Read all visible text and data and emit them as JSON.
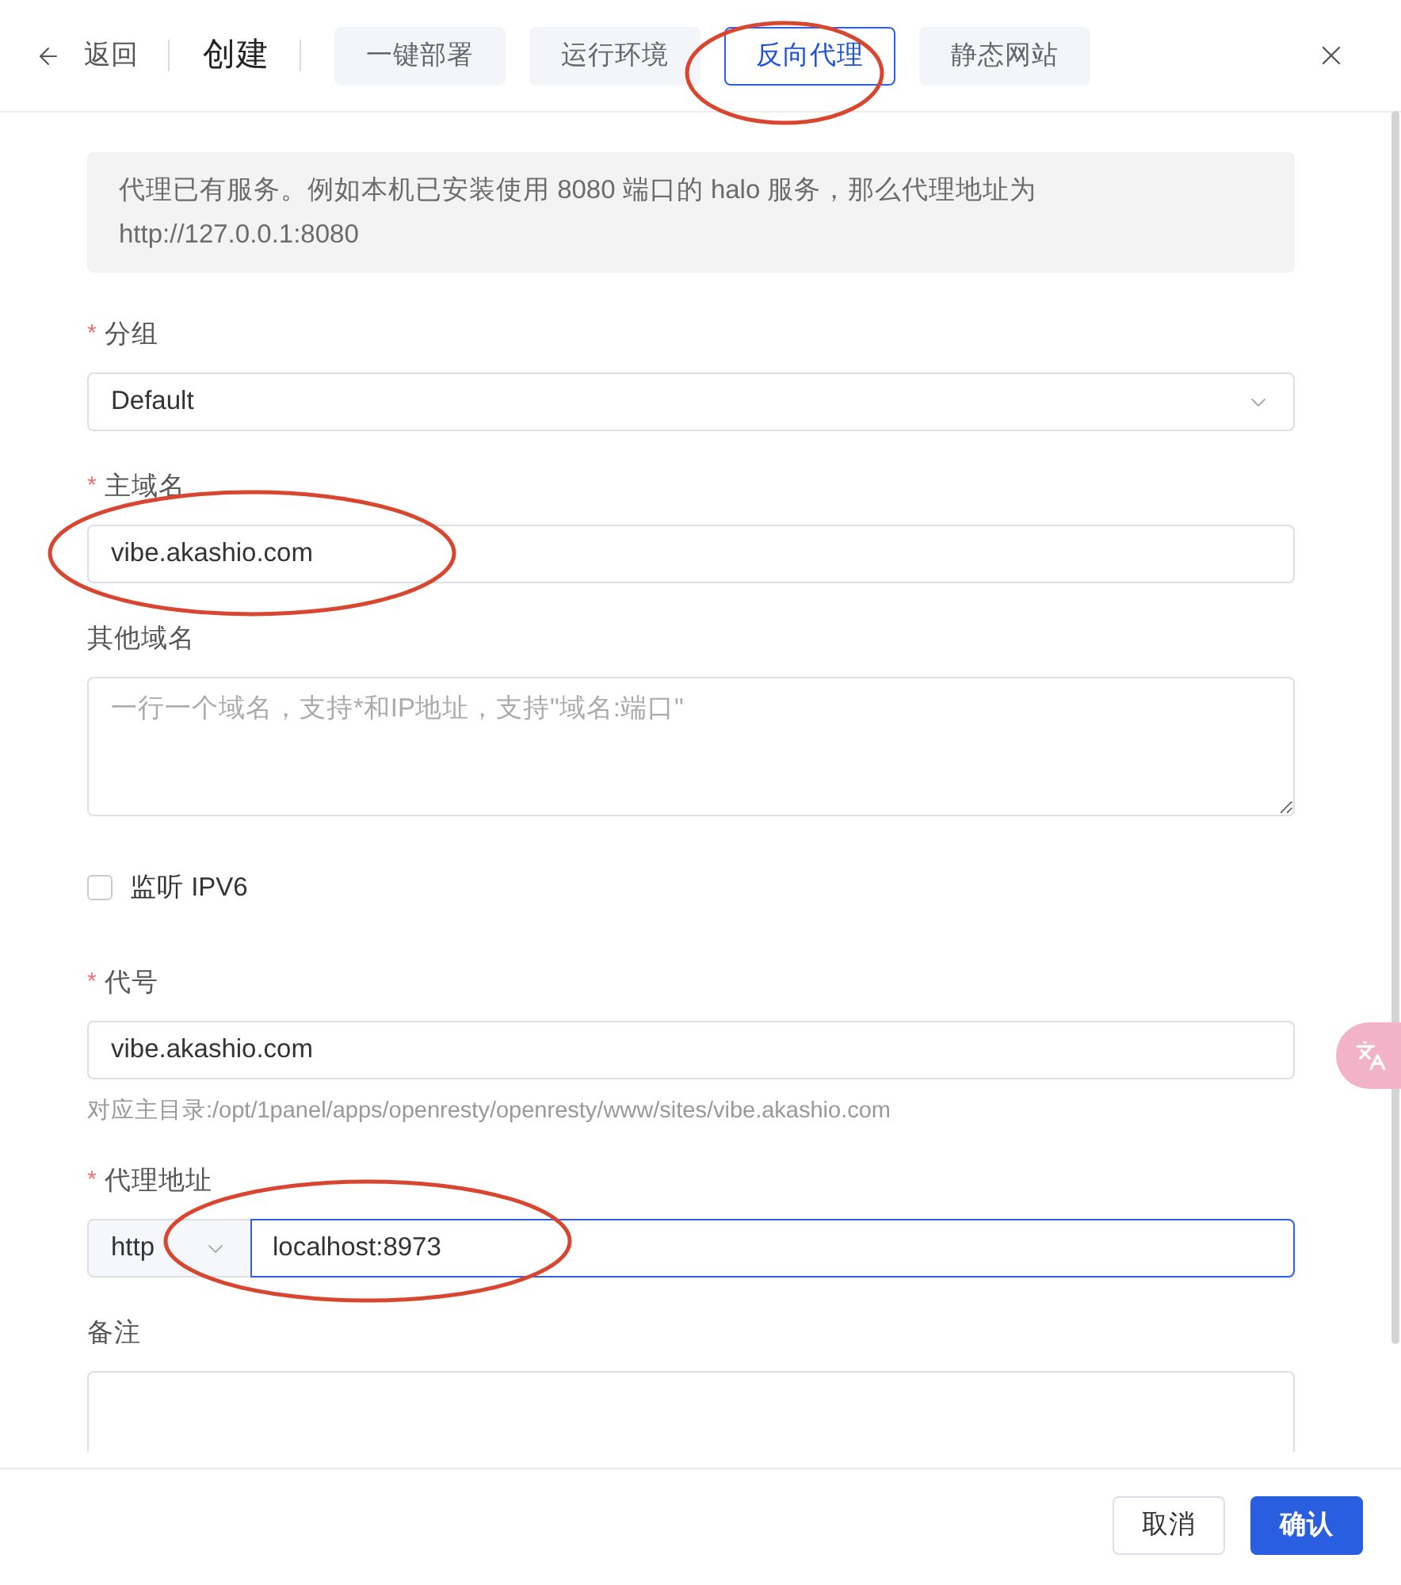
{
  "header": {
    "back": {
      "label": "返回"
    },
    "title": "创建",
    "tabs": [
      {
        "label": "一键部署",
        "selected": false,
        "annotated": false
      },
      {
        "label": "运行环境",
        "selected": false,
        "annotated": false
      },
      {
        "label": "反向代理",
        "selected": true,
        "annotated": true
      },
      {
        "label": "静态网站",
        "selected": false,
        "annotated": false
      }
    ]
  },
  "info": {
    "text": "代理已有服务。例如本机已安装使用 8080 端口的 halo 服务，那么代理地址为 http://127.0.0.1:8080"
  },
  "form": {
    "fields": [
      {
        "kind": "select",
        "required_mark": "*",
        "label": "分组",
        "value": "Default"
      },
      {
        "kind": "input",
        "required_mark": "*",
        "label": "主域名",
        "value": "vibe.akashio.com",
        "annotated": true
      },
      {
        "kind": "textarea",
        "label": "其他域名",
        "placeholder": "一行一个域名，支持*和IP地址，支持\"域名:端口\""
      },
      {
        "kind": "checkbox",
        "label": "监听 IPV6",
        "checked": false
      },
      {
        "kind": "input",
        "required_mark": "*",
        "label": "代号",
        "value": "vibe.akashio.com",
        "hint": "对应主目录:/opt/1panel/apps/openresty/openresty/www/sites/vibe.akashio.com"
      },
      {
        "kind": "proxy",
        "required_mark": "*",
        "label": "代理地址",
        "scheme": "http",
        "value": "localhost:8973",
        "focused": true,
        "annotated": true
      },
      {
        "kind": "note",
        "label": "备注"
      }
    ]
  },
  "footer": {
    "buttons": [
      {
        "kind": "secondary",
        "label": "取消"
      },
      {
        "kind": "primary",
        "label": "确认"
      }
    ]
  }
}
